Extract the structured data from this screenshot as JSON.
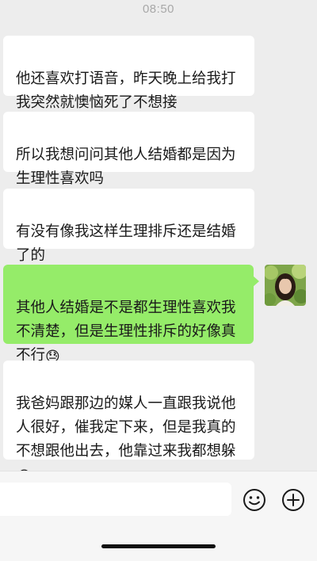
{
  "status": {
    "time": "08:50"
  },
  "messages": [
    {
      "side": "left",
      "text": "他还喜欢打语音，昨天晚上给我打我突然就懊恼死了不想接"
    },
    {
      "side": "left",
      "text": "所以我想问问其他人结婚都是因为生理性喜欢吗"
    },
    {
      "side": "left",
      "text": "有没有像我这样生理排斥还是结婚了的"
    },
    {
      "side": "right",
      "text": "其他人结婚是不是都生理性喜欢我不清楚，但是生理性排斥的好像真不行",
      "emoji": "😓"
    },
    {
      "side": "left",
      "text": "我爸妈跟那边的媒人一直跟我说他人很好，催我定下来，但是我真的不想跟他出去，他靠过来我都想躲",
      "emoji": "😭"
    }
  ],
  "input": {
    "value": "",
    "placeholder": ""
  },
  "icons": {
    "emoji_button": "smiley-face-icon",
    "more_button": "plus-circle-icon"
  },
  "colors": {
    "background": "#ededed",
    "incoming_bubble": "#ffffff",
    "outgoing_bubble": "#95ec69"
  }
}
